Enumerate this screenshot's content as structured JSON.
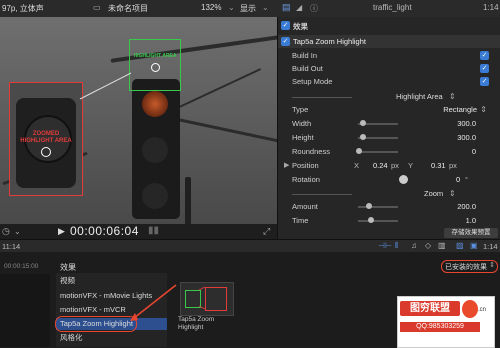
{
  "topbar": {
    "format": "97p, 立体声",
    "project": "未命名项目",
    "zoom": "132%",
    "display": "显示",
    "clip_name": "traffic_light",
    "duration": "1:14"
  },
  "viewer": {
    "zoomed_label": "ZOOMED\nHIGHLIGHT AREA",
    "highlight_label": "HIGHLIGHT AREA",
    "timecode": "00:00:06:04"
  },
  "inspector": {
    "section_title": "效果",
    "effect_name": "Tap5a Zoom Highlight",
    "build_in": "Build In",
    "build_out": "Build Out",
    "setup_mode": "Setup Mode",
    "group_highlight": "Highlight Area",
    "type_label": "Type",
    "type_value": "Rectangle",
    "width_label": "Width",
    "width_value": "300.0",
    "height_label": "Height",
    "height_value": "300.0",
    "roundness_label": "Roundness",
    "roundness_value": "0",
    "position_label": "Position",
    "pos_x_label": "X",
    "pos_x_value": "0.24",
    "pos_x_unit": "px",
    "pos_y_label": "Y",
    "pos_y_value": "0.31",
    "pos_y_unit": "px",
    "rotation_label": "Rotation",
    "rotation_value": "0",
    "rotation_unit": "°",
    "group_zoom": "Zoom",
    "amount_label": "Amount",
    "amount_value": "200.0",
    "time_label": "Time",
    "time_value": "1.0",
    "save_preset": "存储效果预置"
  },
  "timeline": {
    "left_time": "11:14",
    "ruler_time": "00:00:15:00",
    "right_time": "1:14"
  },
  "browser": {
    "title": "效果",
    "installed_label": "已安装的效果",
    "categories": [
      "视频",
      "motionVFX - mMovie Lights",
      "motionVFX - mVCR",
      "Tap5a Zoom Highlight",
      "风格化"
    ],
    "selected_index": 3,
    "thumb_caption": "Tap5a Zoom Highlight"
  },
  "watermark": {
    "brand": "图穷联盟",
    "qq": "QQ:985303259",
    "suffix": ".cn"
  },
  "colors": {
    "accent": "#3a7bd5",
    "zoomed_box": "#e23b3b",
    "highlight_box": "#38c94a",
    "annotation": "#e8462f"
  }
}
